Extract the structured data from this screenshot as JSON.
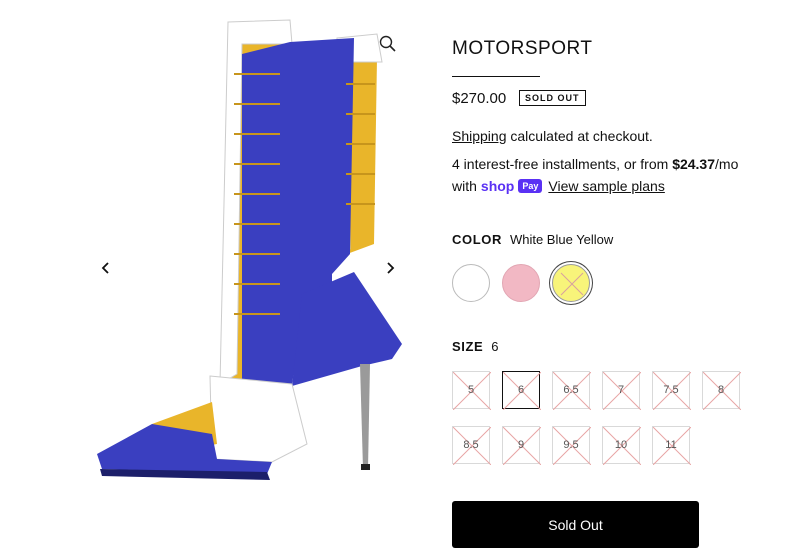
{
  "product": {
    "title": "MOTORSPORT",
    "price": "$270.00",
    "badge": "SOLD OUT"
  },
  "shipping": {
    "link": "Shipping",
    "text": " calculated at checkout."
  },
  "installments": {
    "prefix": "4 interest-free installments, or from ",
    "amount": "$24.37",
    "suffix": "/mo",
    "with": "with",
    "shop_logo": "shop",
    "pay_badge": "Pay",
    "sample_link": "View sample plans"
  },
  "color": {
    "label": "COLOR",
    "selected": "White Blue Yellow",
    "swatches": [
      {
        "name": "white",
        "hex": "#ffffff"
      },
      {
        "name": "pink",
        "hex": "#f2b8c4"
      },
      {
        "name": "yellow",
        "hex": "#f8f47a"
      }
    ]
  },
  "size": {
    "label": "SIZE",
    "selected": "6",
    "options": [
      "5",
      "6",
      "6.5",
      "7",
      "7.5",
      "8",
      "8.5",
      "9",
      "9.5",
      "10",
      "11"
    ]
  },
  "cta": {
    "label": "Sold Out"
  },
  "gallery": {
    "icons": [
      "zoom-icon",
      "chevron-left-icon",
      "chevron-right-icon"
    ]
  },
  "colors": {
    "boot_blue": "#3a3fc0",
    "boot_yellow": "#e9b52a",
    "shop_purple": "#5a31f4",
    "button": "#000000"
  }
}
